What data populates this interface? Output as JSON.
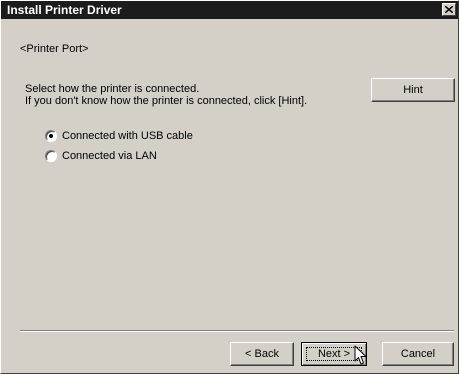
{
  "window": {
    "title": "Install Printer Driver",
    "close_glyph": "x"
  },
  "section": {
    "label": "<Printer Port>"
  },
  "instruction": {
    "line1": "Select how the printer is connected.",
    "line2": "If you don't know how the printer is connected, click [Hint]."
  },
  "hint_button": {
    "label": "Hint"
  },
  "options": [
    {
      "label": "Connected with USB cable",
      "selected": true
    },
    {
      "label": "Connected via LAN",
      "selected": false
    }
  ],
  "footer": {
    "back_label": "< Back",
    "next_label": "Next >",
    "cancel_label": "Cancel"
  },
  "icons": {
    "close": "close-icon",
    "cursor": "hand-pointer-cursor-icon"
  },
  "colors": {
    "titlebar": "#1c1c1c",
    "dialog_face": "#d4d0c8"
  }
}
